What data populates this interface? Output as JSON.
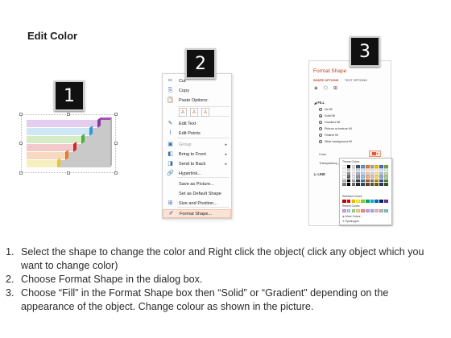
{
  "title": "Edit Color",
  "steps": [
    "1",
    "2",
    "3"
  ],
  "context_menu": {
    "items": [
      {
        "icon": "scissors-icon",
        "glyph": "✂",
        "label": "Cut",
        "dim": false,
        "arrow": false
      },
      {
        "icon": "copy-icon",
        "glyph": "⎘",
        "label": "Copy",
        "dim": false,
        "arrow": false
      },
      {
        "icon": "clipboard-icon",
        "glyph": "📋",
        "label": "Paste Options:",
        "dim": false,
        "arrow": false
      },
      {
        "icon": "edit-text-icon",
        "glyph": "✎",
        "label": "Edit Text",
        "dim": false,
        "arrow": false
      },
      {
        "icon": "edit-points-icon",
        "glyph": "⌇",
        "label": "Edit Points",
        "dim": false,
        "arrow": false
      },
      {
        "icon": "group-icon",
        "glyph": "▣",
        "label": "Group",
        "dim": true,
        "arrow": true
      },
      {
        "icon": "bring-to-front-icon",
        "glyph": "◧",
        "label": "Bring to Front",
        "dim": false,
        "arrow": true
      },
      {
        "icon": "send-to-back-icon",
        "glyph": "◨",
        "label": "Send to Back",
        "dim": false,
        "arrow": true
      },
      {
        "icon": "hyperlink-icon",
        "glyph": "🔗",
        "label": "Hyperlink...",
        "dim": false,
        "arrow": false
      },
      {
        "icon": "save-picture-icon",
        "glyph": "",
        "label": "Save as Picture...",
        "dim": false,
        "arrow": false
      },
      {
        "icon": "default-shape-icon",
        "glyph": "",
        "label": "Set as Default Shape",
        "dim": false,
        "arrow": false
      },
      {
        "icon": "size-position-icon",
        "glyph": "⊞",
        "label": "Size and Position...",
        "dim": false,
        "arrow": false
      },
      {
        "icon": "format-shape-icon",
        "glyph": "✐",
        "label": "Format Shape...",
        "dim": false,
        "arrow": false
      }
    ],
    "paste_buttons": [
      "A",
      "A",
      "A"
    ]
  },
  "format_shape": {
    "title": "Format Shape",
    "tabs": [
      "SHAPE OPTIONS",
      "TEXT OPTIONS"
    ],
    "fill_header": "FILL",
    "fill_options": [
      {
        "label": "No fill",
        "selected": false
      },
      {
        "label": "Solid fill",
        "selected": true
      },
      {
        "label": "Gradient fill",
        "selected": false
      },
      {
        "label": "Picture or texture fill",
        "selected": false
      },
      {
        "label": "Pattern fill",
        "selected": false
      },
      {
        "label": "Slide background fill",
        "selected": false
      }
    ],
    "color_label": "Color",
    "transparency_label": "Transparency",
    "line_header": "LINE",
    "accent": "#b7472a"
  },
  "palette": {
    "theme_header": "Theme Colors",
    "standard_header": "Standard Colors",
    "recent_header": "Recent Colors",
    "more_colors": "More Colors...",
    "eyedropper": "Eyedropper",
    "theme_top": [
      "#ffffff",
      "#000000",
      "#e7e6e6",
      "#44546a",
      "#5b9bd5",
      "#ed7d31",
      "#a5a5a5",
      "#ffc000",
      "#4472c4",
      "#70ad47"
    ],
    "standard": [
      "#c00000",
      "#ff0000",
      "#ffc000",
      "#ffff00",
      "#92d050",
      "#00b050",
      "#00b0f0",
      "#0070c0",
      "#002060",
      "#7030a0"
    ],
    "recent": [
      "#d9a0d9",
      "#9cd9f0",
      "#a7d98a",
      "#f7d17a",
      "#f28a8a",
      "#c7a2e6",
      "#9ab0e8",
      "#f5b0c8",
      "#b8b8b8",
      "#7ecbc4"
    ]
  },
  "instructions": [
    {
      "num": "1.",
      "text": "Select the shape to change the color and Right click the object( click any object which you want to change color)"
    },
    {
      "num": "2.",
      "text": "Choose Format Shape in the dialog box."
    },
    {
      "num": "3.",
      "text": "Choose “Fill” in the Format Shape box then “Solid” or “Gradient” depending on the appearance of the object. Change colour as shown in the picture."
    }
  ]
}
